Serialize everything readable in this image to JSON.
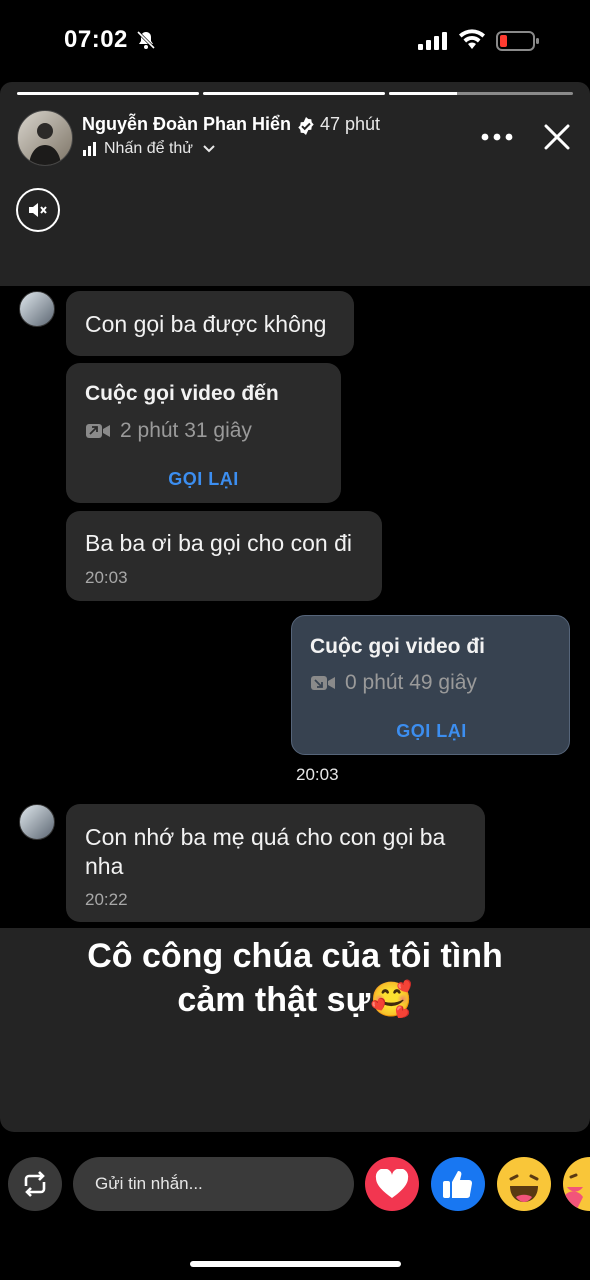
{
  "status_bar": {
    "time": "07:02"
  },
  "story": {
    "author": "Nguyễn Đoàn Phan Hiển",
    "time_ago": "47 phút",
    "subtitle": "Nhấn để thử",
    "progress": [
      1.0,
      1.0,
      0.37
    ]
  },
  "chat": {
    "messages": [
      {
        "text": "Con gọi ba được không"
      },
      {
        "call_title": "Cuộc gọi video đến",
        "duration": "2 phút 31 giây",
        "action": "GỌI LẠI"
      },
      {
        "text": "Ba ba ơi ba gọi cho con đi",
        "time": "20:03"
      },
      {
        "call_title": "Cuộc gọi video đi",
        "duration": "0 phút 49 giây",
        "action": "GỌI LẠI",
        "time": "20:03"
      },
      {
        "text_line1": "Con nhớ ba mẹ quá cho con gọi ba",
        "text_line2": "nha",
        "time": "20:22"
      }
    ]
  },
  "caption": {
    "line1": "Cô công chúa của tôi tình",
    "line2": "cảm thật sự🥰"
  },
  "reply": {
    "placeholder": "Gửi tin nhắn..."
  },
  "colors": {
    "accent": "#3c8ef0",
    "heart": "#f23650",
    "like": "#1877f2",
    "panel": "#242424",
    "bubble": "#2b2b2b"
  }
}
